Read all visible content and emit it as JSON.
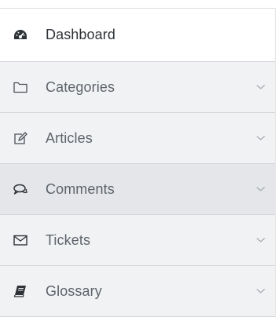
{
  "sidebar": {
    "items": [
      {
        "label": "Dashboard",
        "icon": "dashboard-icon",
        "active": true,
        "has_submenu": false
      },
      {
        "label": "Categories",
        "icon": "folder-icon",
        "active": false,
        "has_submenu": true
      },
      {
        "label": "Articles",
        "icon": "edit-icon",
        "active": false,
        "has_submenu": true
      },
      {
        "label": "Comments",
        "icon": "comments-icon",
        "active": false,
        "has_submenu": true
      },
      {
        "label": "Tickets",
        "icon": "envelope-icon",
        "active": false,
        "has_submenu": true
      },
      {
        "label": "Glossary",
        "icon": "book-icon",
        "active": false,
        "has_submenu": true
      }
    ]
  },
  "colors": {
    "item_bg": "#f1f2f4",
    "active_bg": "#ffffff",
    "hover_bg": "#e4e6e9",
    "text": "#5e646b"
  }
}
